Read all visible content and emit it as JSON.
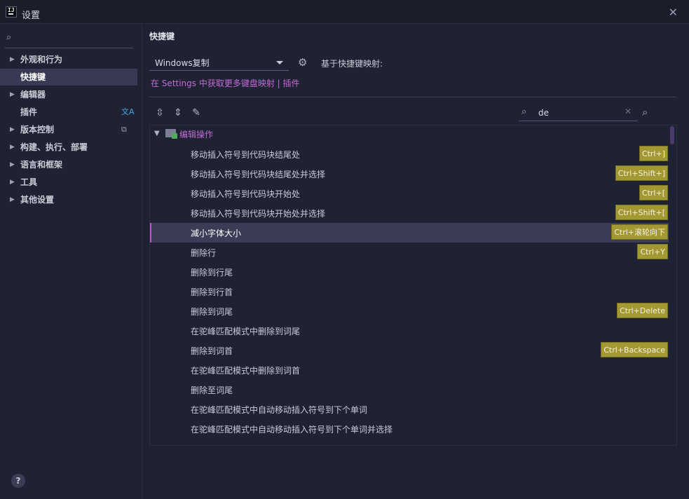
{
  "window": {
    "title": "设置",
    "app_icon": "intellij-idea-icon",
    "close_icon": "close-icon"
  },
  "sidebar": {
    "search_placeholder": "",
    "items": [
      {
        "label": "外观和行为",
        "expandable": true,
        "active": false
      },
      {
        "label": "快捷键",
        "expandable": false,
        "active": true
      },
      {
        "label": "编辑器",
        "expandable": true,
        "active": false
      },
      {
        "label": "插件",
        "expandable": false,
        "active": false,
        "trail_icon": "translate-icon",
        "trail_glyph": "文A"
      },
      {
        "label": "版本控制",
        "expandable": true,
        "active": false,
        "trail_icon": "copy-icon",
        "trail_glyph": "⧉"
      },
      {
        "label": "构建、执行、部署",
        "expandable": true,
        "active": false
      },
      {
        "label": "语言和框架",
        "expandable": true,
        "active": false
      },
      {
        "label": "工具",
        "expandable": true,
        "active": false
      },
      {
        "label": "其他设置",
        "expandable": true,
        "active": false
      }
    ],
    "help_label": "?"
  },
  "main": {
    "title": "快捷键",
    "keymap": {
      "selected": "Windows复制",
      "description": "基于快捷键映射:"
    },
    "plugin_link": "在 Settings 中获取更多键盘映射 | 插件",
    "filter": {
      "value": "de",
      "placeholder": ""
    },
    "tree": {
      "group_label": "编辑操作",
      "rows": [
        {
          "label": "移动插入符号到代码块结尾处",
          "shortcut": "Ctrl+]"
        },
        {
          "label": "移动插入符号到代码块结尾处并选择",
          "shortcut": "Ctrl+Shift+]"
        },
        {
          "label": "移动插入符号到代码块开始处",
          "shortcut": "Ctrl+["
        },
        {
          "label": "移动插入符号到代码块开始处并选择",
          "shortcut": "Ctrl+Shift+["
        },
        {
          "label": "减小字体大小",
          "shortcut": "Ctrl+滚轮向下",
          "selected": true
        },
        {
          "label": "删除行",
          "shortcut": "Ctrl+Y"
        },
        {
          "label": "删除到行尾",
          "shortcut": ""
        },
        {
          "label": "删除到行首",
          "shortcut": ""
        },
        {
          "label": "删除到词尾",
          "shortcut": "Ctrl+Delete"
        },
        {
          "label": "在驼峰匹配模式中删除到词尾",
          "shortcut": ""
        },
        {
          "label": "删除到词首",
          "shortcut": "Ctrl+Backspace"
        },
        {
          "label": "在驼峰匹配模式中删除到词首",
          "shortcut": ""
        },
        {
          "label": "删除至词尾",
          "shortcut": ""
        },
        {
          "label": "在驼峰匹配模式中自动移动插入符号到下个单词",
          "shortcut": ""
        },
        {
          "label": "在驼峰匹配模式中自动移动插入符号到下个单词并选择",
          "shortcut": ""
        }
      ]
    }
  },
  "colors": {
    "background": "#1f2233",
    "accent_purple": "#c46ad4",
    "shortcut_badge": "#a49833",
    "selection": "#3a3d55"
  }
}
